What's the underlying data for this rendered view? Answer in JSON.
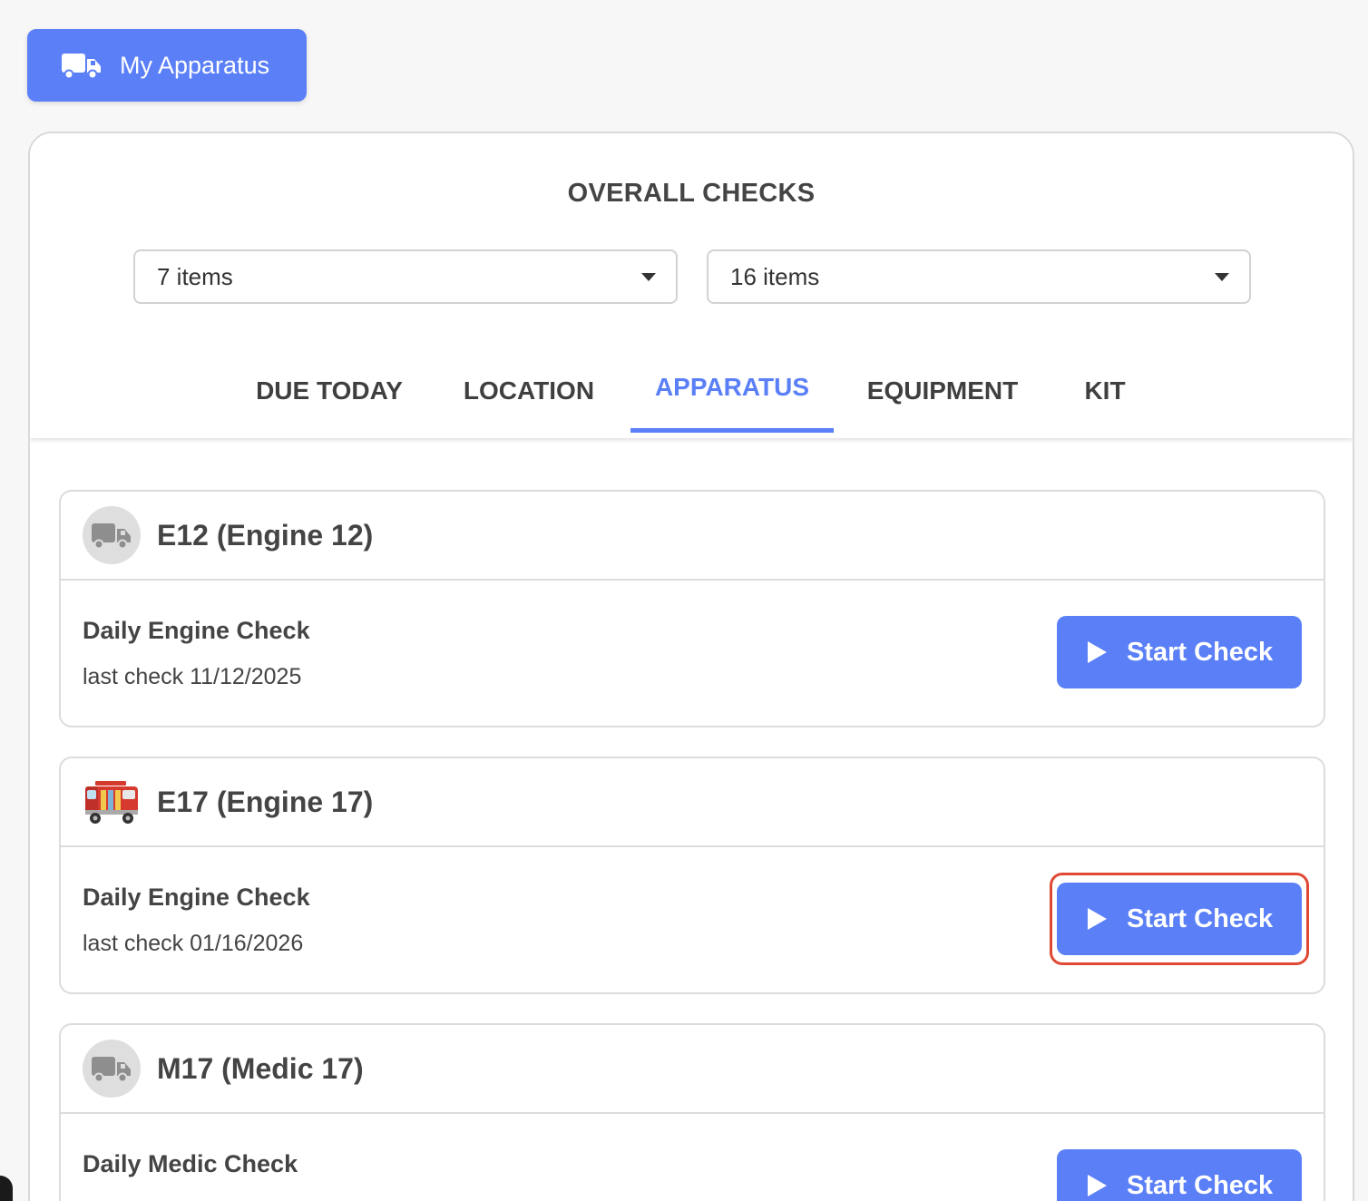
{
  "header": {
    "button_label": "My Apparatus",
    "icon": "truck-icon"
  },
  "overall": {
    "title": "OVERALL CHECKS",
    "select_left": {
      "value": "7 items"
    },
    "select_right": {
      "value": "16 items"
    }
  },
  "tabs": [
    {
      "label": "DUE TODAY",
      "active": false
    },
    {
      "label": "LOCATION",
      "active": false
    },
    {
      "label": "APPARATUS",
      "active": true
    },
    {
      "label": "EQUIPMENT",
      "active": false
    },
    {
      "label": "KIT",
      "active": false
    }
  ],
  "apparatus": [
    {
      "name": "E12 (Engine 12)",
      "avatar": "truck-icon",
      "check_name": "Daily Engine Check",
      "last_check": "last check 11/12/2025",
      "button_label": "Start Check"
    },
    {
      "name": "E17 (Engine 17)",
      "avatar": "fire-engine-photo",
      "check_name": "Daily Engine Check",
      "last_check": "last check 01/16/2026",
      "button_label": "Start Check",
      "highlighted": true
    },
    {
      "name": "M17 (Medic 17)",
      "avatar": "truck-icon",
      "check_name": "Daily Medic Check",
      "button_label": "Start Check"
    }
  ],
  "colors": {
    "accent": "#5a7ff7",
    "highlight_border": "#e04a35"
  }
}
